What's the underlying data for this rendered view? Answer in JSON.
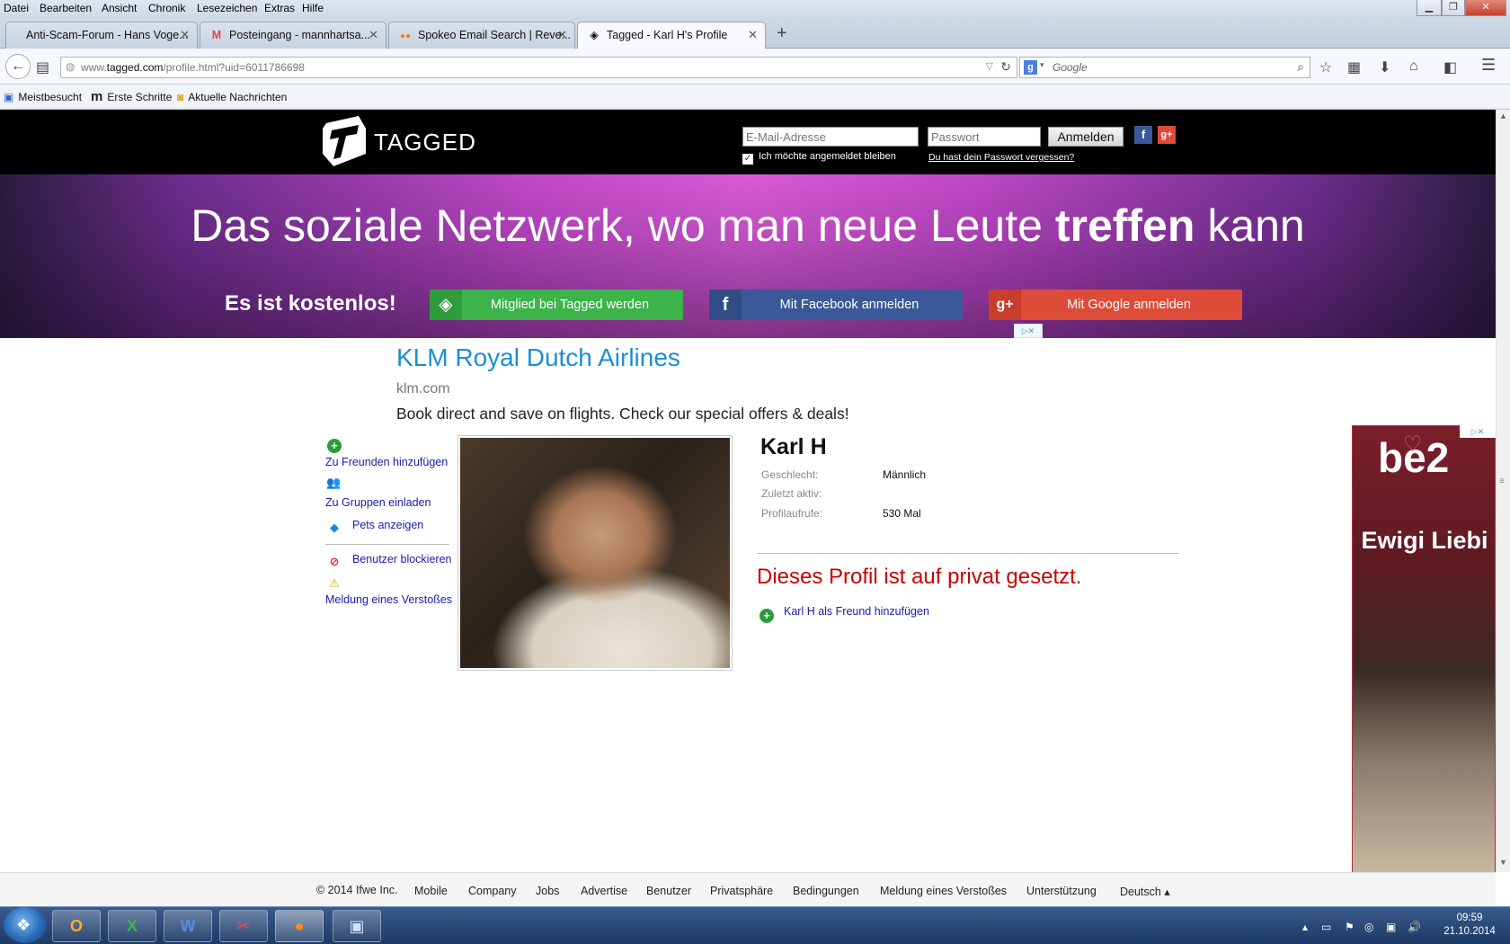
{
  "menubar": {
    "items": [
      "Datei",
      "Bearbeiten",
      "Ansicht",
      "Chronik",
      "Lesezeichen",
      "Extras",
      "Hilfe"
    ]
  },
  "tabs": [
    {
      "label": "Anti-Scam-Forum - Hans Voge...",
      "icon": "forum-icon"
    },
    {
      "label": "Posteingang - mannhartsa...",
      "icon": "gmail-icon"
    },
    {
      "label": "Spokeo Email Search | Reve...",
      "icon": "spokeo-icon"
    },
    {
      "label": "Tagged - Karl H's Profile",
      "icon": "tagged-icon"
    }
  ],
  "new_tab": "+",
  "url": {
    "prefix": "www.",
    "domain": "tagged.com",
    "path": "/profile.html?uid=6011786698"
  },
  "search": {
    "placeholder": "Google"
  },
  "bookmarks": [
    {
      "label": "Meistbesucht",
      "icon": "most-visited-icon"
    },
    {
      "label": "Erste Schritte",
      "icon": "getting-started-icon"
    },
    {
      "label": "Aktuelle Nachrichten",
      "icon": "rss-icon"
    }
  ],
  "site": {
    "logo_text": "TAGGED",
    "email_placeholder": "E-Mail-Adresse",
    "password_placeholder": "Passwort",
    "login_label": "Anmelden",
    "remember_label": "Ich möchte angemeldet bleiben",
    "forgot_label": "Du hast dein Passwort vergessen?",
    "headline_pre": "Das soziale Netzwerk, wo man neue Leute ",
    "headline_bold": "treffen",
    "headline_post": " kann",
    "free_label": "Es ist kostenlos!",
    "cta_tagged": "Mitglied bei Tagged werden",
    "cta_facebook": "Mit Facebook anmelden",
    "cta_google": "Mit Google anmelden",
    "colors": {
      "tagged_green": "#3cb44a",
      "facebook_blue": "#3b5998",
      "google_red": "#dd4b39",
      "private_red": "#cc0000",
      "link_blue": "#1a1ab0"
    }
  },
  "ad": {
    "title": "KLM Royal Dutch Airlines",
    "url": "klm.com",
    "desc": "Book direct and save on flights. Check our special offers & deals!"
  },
  "actions": {
    "add_friend": "Zu Freunden hinzufügen",
    "invite_groups": "Zu Gruppen einladen",
    "show_pets": "Pets anzeigen",
    "block_user": "Benutzer blockieren",
    "report": "Meldung eines Verstoßes"
  },
  "profile": {
    "name": "Karl H",
    "gender_label": "Geschlecht:",
    "gender_value": "Männlich",
    "last_active_label": "Zuletzt aktiv:",
    "views_label": "Profilaufrufe:",
    "views_value": "530 Mal",
    "private_msg": "Dieses Profil ist auf privat gesetzt.",
    "add_as_friend": "Karl H als Freund hinzufügen"
  },
  "side_ad": {
    "brand": "be2",
    "slogan": "Ewigi Liebi"
  },
  "footer": {
    "copyright": "© 2014 Ifwe Inc.",
    "links": [
      "Mobile",
      "Company",
      "Jobs",
      "Advertise",
      "Benutzer",
      "Privatsphäre",
      "Bedingungen",
      "Meldung eines Verstoßes",
      "Unterstützung"
    ],
    "language": "Deutsch ▴"
  },
  "taskbar": {
    "apps": [
      {
        "name": "outlook",
        "glyph": "O"
      },
      {
        "name": "excel",
        "glyph": "X"
      },
      {
        "name": "word",
        "glyph": "W"
      },
      {
        "name": "snipping-tool",
        "glyph": "✂"
      },
      {
        "name": "firefox",
        "glyph": "●"
      },
      {
        "name": "remote-desktop",
        "glyph": "▣"
      }
    ],
    "time": "09:59",
    "date": "21.10.2014"
  }
}
